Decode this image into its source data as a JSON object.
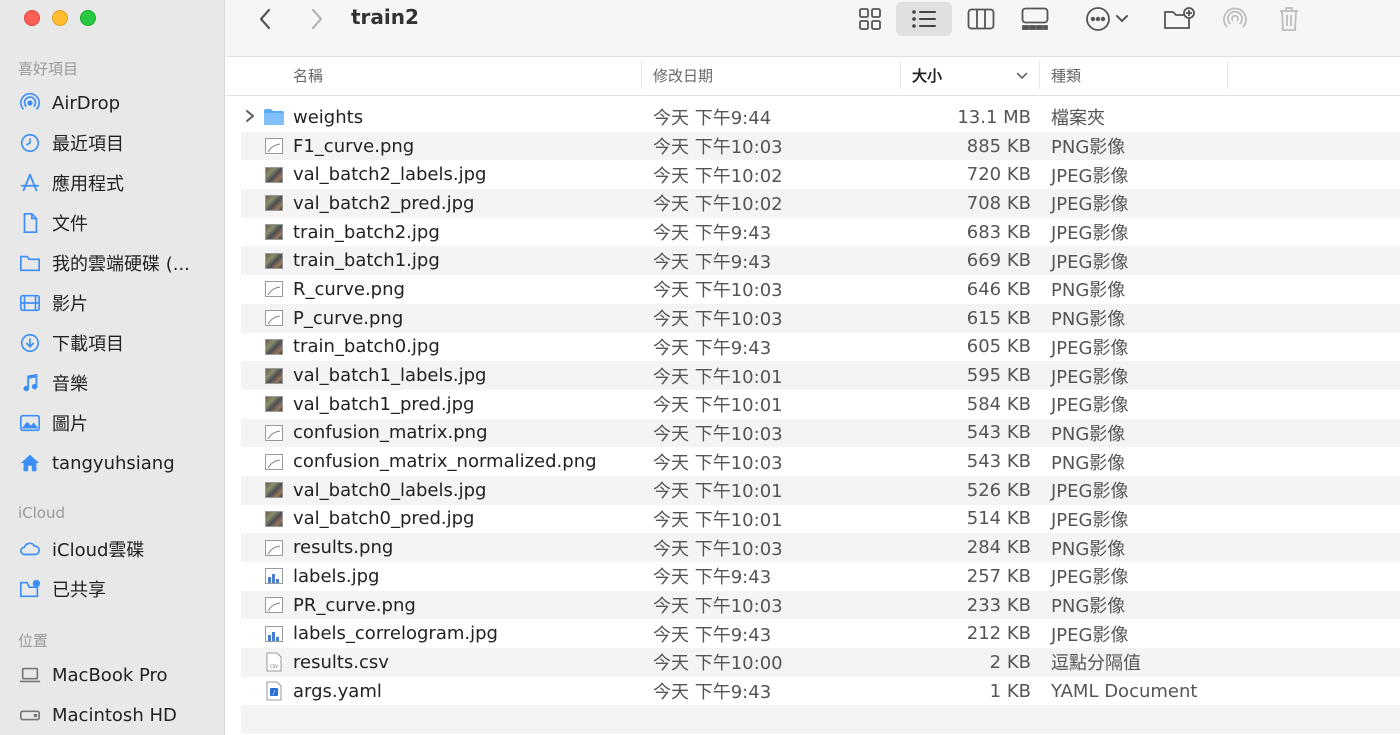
{
  "window": {
    "title": "train2"
  },
  "sidebar": {
    "sections": [
      {
        "title": "喜好項目",
        "items": [
          {
            "label": "AirDrop",
            "icon": "airdrop-icon"
          },
          {
            "label": "最近項目",
            "icon": "clock-icon"
          },
          {
            "label": "應用程式",
            "icon": "applications-icon"
          },
          {
            "label": "文件",
            "icon": "document-icon"
          },
          {
            "label": "我的雲端硬碟 (...",
            "icon": "folder-icon"
          },
          {
            "label": "影片",
            "icon": "film-icon"
          },
          {
            "label": "下載項目",
            "icon": "download-icon"
          },
          {
            "label": "音樂",
            "icon": "music-icon"
          },
          {
            "label": "圖片",
            "icon": "photo-icon"
          },
          {
            "label": "tangyuhsiang",
            "icon": "home-icon"
          }
        ]
      },
      {
        "title": "iCloud",
        "items": [
          {
            "label": "iCloud雲碟",
            "icon": "cloud-icon"
          },
          {
            "label": "已共享",
            "icon": "shared-folder-icon"
          }
        ]
      },
      {
        "title": "位置",
        "items": [
          {
            "label": "MacBook Pro",
            "icon": "laptop-icon"
          },
          {
            "label": "Macintosh HD",
            "icon": "disk-icon"
          }
        ]
      }
    ]
  },
  "columns": {
    "name": "名稱",
    "date": "修改日期",
    "size": "大小",
    "kind": "種類"
  },
  "accent": "#3d8ff7",
  "files": [
    {
      "name": "weights",
      "date": "今天 下午9:44",
      "size": "13.1 MB",
      "kind": "檔案夾",
      "type": "folder"
    },
    {
      "name": "F1_curve.png",
      "date": "今天 下午10:03",
      "size": "885 KB",
      "kind": "PNG影像",
      "type": "png"
    },
    {
      "name": "val_batch2_labels.jpg",
      "date": "今天 下午10:02",
      "size": "720 KB",
      "kind": "JPEG影像",
      "type": "photo"
    },
    {
      "name": "val_batch2_pred.jpg",
      "date": "今天 下午10:02",
      "size": "708 KB",
      "kind": "JPEG影像",
      "type": "photo"
    },
    {
      "name": "train_batch2.jpg",
      "date": "今天 下午9:43",
      "size": "683 KB",
      "kind": "JPEG影像",
      "type": "photo"
    },
    {
      "name": "train_batch1.jpg",
      "date": "今天 下午9:43",
      "size": "669 KB",
      "kind": "JPEG影像",
      "type": "photo"
    },
    {
      "name": "R_curve.png",
      "date": "今天 下午10:03",
      "size": "646 KB",
      "kind": "PNG影像",
      "type": "png"
    },
    {
      "name": "P_curve.png",
      "date": "今天 下午10:03",
      "size": "615 KB",
      "kind": "PNG影像",
      "type": "png"
    },
    {
      "name": "train_batch0.jpg",
      "date": "今天 下午9:43",
      "size": "605 KB",
      "kind": "JPEG影像",
      "type": "photo"
    },
    {
      "name": "val_batch1_labels.jpg",
      "date": "今天 下午10:01",
      "size": "595 KB",
      "kind": "JPEG影像",
      "type": "photo"
    },
    {
      "name": "val_batch1_pred.jpg",
      "date": "今天 下午10:01",
      "size": "584 KB",
      "kind": "JPEG影像",
      "type": "photo"
    },
    {
      "name": "confusion_matrix.png",
      "date": "今天 下午10:03",
      "size": "543 KB",
      "kind": "PNG影像",
      "type": "png"
    },
    {
      "name": "confusion_matrix_normalized.png",
      "date": "今天 下午10:03",
      "size": "543 KB",
      "kind": "PNG影像",
      "type": "png"
    },
    {
      "name": "val_batch0_labels.jpg",
      "date": "今天 下午10:01",
      "size": "526 KB",
      "kind": "JPEG影像",
      "type": "photo"
    },
    {
      "name": "val_batch0_pred.jpg",
      "date": "今天 下午10:01",
      "size": "514 KB",
      "kind": "JPEG影像",
      "type": "photo"
    },
    {
      "name": "results.png",
      "date": "今天 下午10:03",
      "size": "284 KB",
      "kind": "PNG影像",
      "type": "png"
    },
    {
      "name": "labels.jpg",
      "date": "今天 下午9:43",
      "size": "257 KB",
      "kind": "JPEG影像",
      "type": "chart"
    },
    {
      "name": "PR_curve.png",
      "date": "今天 下午10:03",
      "size": "233 KB",
      "kind": "PNG影像",
      "type": "png"
    },
    {
      "name": "labels_correlogram.jpg",
      "date": "今天 下午9:43",
      "size": "212 KB",
      "kind": "JPEG影像",
      "type": "chart"
    },
    {
      "name": "results.csv",
      "date": "今天 下午10:00",
      "size": "2 KB",
      "kind": "逗點分隔值",
      "type": "csv"
    },
    {
      "name": "args.yaml",
      "date": "今天 下午9:43",
      "size": "1 KB",
      "kind": "YAML Document",
      "type": "yaml"
    }
  ]
}
